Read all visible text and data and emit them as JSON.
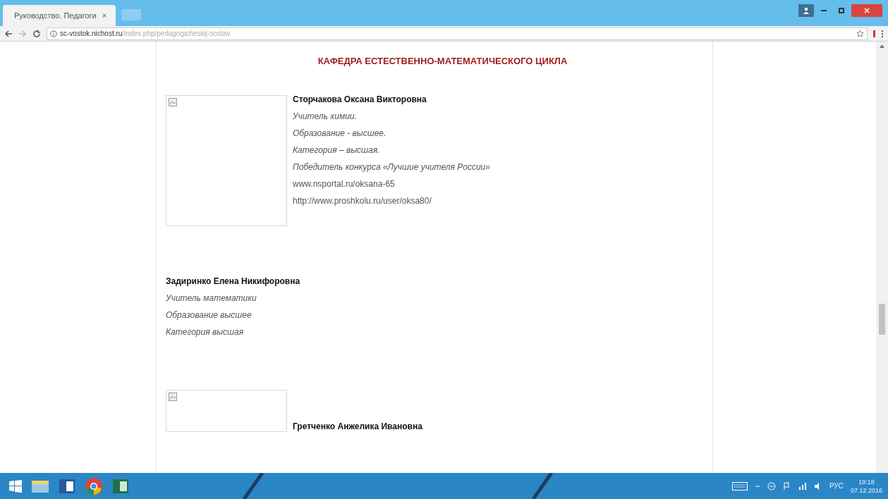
{
  "browser": {
    "tabs": [
      {
        "title": "Руководство. Педагоги",
        "selected": true,
        "close": "×"
      }
    ],
    "url_host": "sc-vostok.nichost.ru",
    "url_path": "/index.php/pedagogicheskij-sostav"
  },
  "page": {
    "heading": "КАФЕДРА ЕСТЕСТВЕННО-МАТЕМАТИЧЕСКОГО ЦИКЛА",
    "people": [
      {
        "kind": "with-photo",
        "name": "Сторчакова Оксана Викторовна",
        "lines": [
          {
            "text": "Учитель химии.",
            "italic": true
          },
          {
            "text": "Образование - высшее.",
            "italic": true
          },
          {
            "text": "Категория – высшая.",
            "italic": true
          },
          {
            "text": "Победитель  конкурса «Лучшие учителя России»",
            "italic": true
          },
          {
            "text": "www.nsportal.ru/oksana-65",
            "italic": false
          },
          {
            "text": "http://www.proshkolu.ru/user/oksa80/",
            "italic": false
          }
        ]
      },
      {
        "kind": "text-only",
        "name": "Задиринко Елена Никифоровна",
        "lines": [
          {
            "text": "Учитель математики",
            "italic": true
          },
          {
            "text": "Образование  высшее",
            "italic": true
          },
          {
            "text": "Категория  высшая",
            "italic": true
          }
        ]
      },
      {
        "kind": "photo-below",
        "name": "Гретченко Анжелика Ивановна"
      }
    ]
  },
  "taskbar": {
    "language": "РУС",
    "time": "19:18",
    "date": "07.12.2016"
  }
}
